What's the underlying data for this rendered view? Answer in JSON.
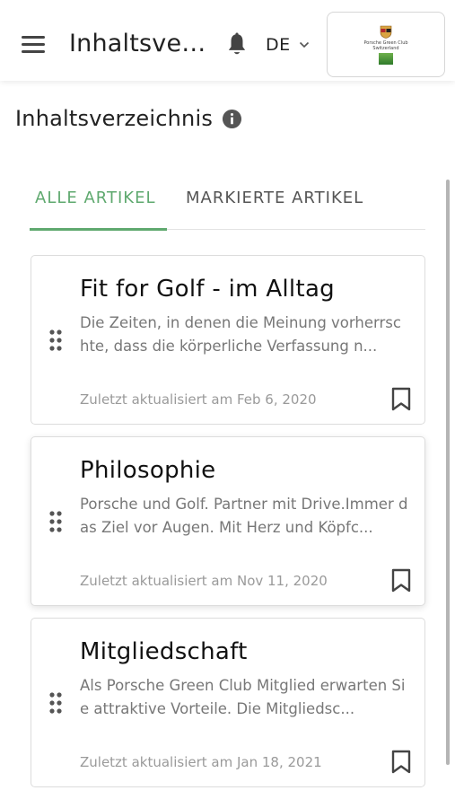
{
  "header": {
    "title": "Inhaltsverz...",
    "language": "DE",
    "logo_text_line1": "Porsche Green Club",
    "logo_text_line2": "Switzerland"
  },
  "page": {
    "title": "Inhaltsverzeichnis"
  },
  "tabs": [
    {
      "label": "ALLE ARTIKEL",
      "active": true
    },
    {
      "label": "MARKIERTE ARTIKEL",
      "active": false
    }
  ],
  "articles": [
    {
      "title": "Fit for Golf - im Alltag",
      "excerpt": "Die Zeiten, in denen die Meinung vorherrsc hte, dass die körperliche Verfassung n...",
      "updated": "Zuletzt aktualisiert am Feb 6, 2020"
    },
    {
      "title": "Philosophie",
      "excerpt": "Porsche und Golf. Partner mit Drive.Immer das Ziel vor Augen. Mit Herz und Köpfc...",
      "updated": "Zuletzt aktualisiert am Nov 11, 2020"
    },
    {
      "title": "Mitgliedschaft",
      "excerpt": "Als Porsche Green Club Mitglied erwarten Sie attraktive Vorteile. Die Mitgliedsc...",
      "updated": "Zuletzt aktualisiert am Jan 18, 2021"
    }
  ],
  "colors": {
    "accent": "#5fa96f",
    "text": "#222222",
    "muted": "#777777"
  },
  "icons": {
    "menu": "hamburger-icon",
    "notifications": "bell-icon",
    "info": "info-icon",
    "drag": "drag-handle-icon",
    "bookmark": "bookmark-icon"
  }
}
